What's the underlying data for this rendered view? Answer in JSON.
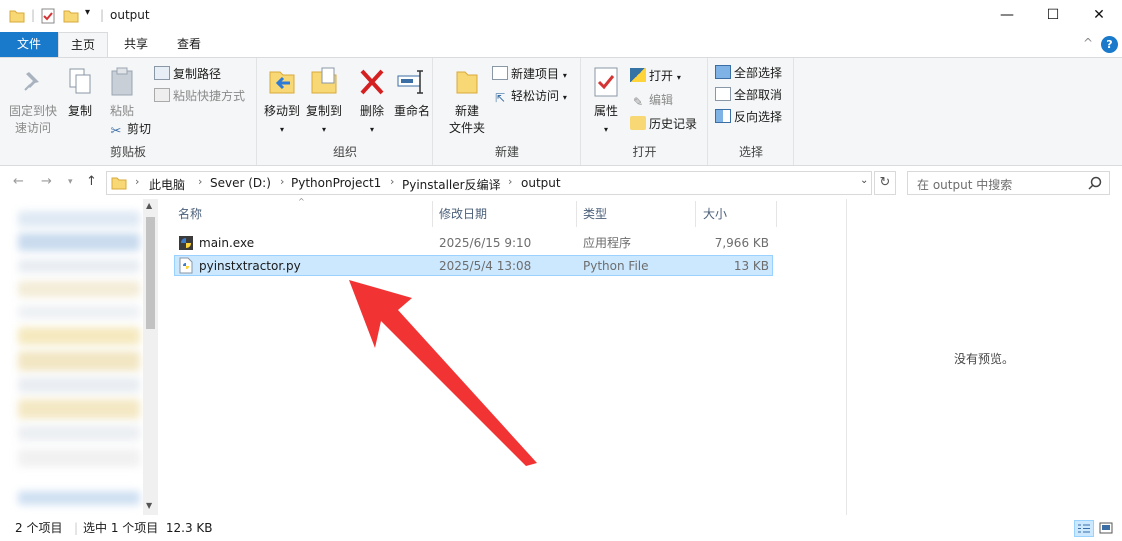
{
  "window": {
    "title": "output",
    "minimize_glyph": "—",
    "maximize_glyph": "☐",
    "close_glyph": "✕"
  },
  "ribbon_tabs": {
    "file": "文件",
    "home": "主页",
    "share": "共享",
    "view": "查看",
    "collapse_glyph": "^",
    "help_glyph": "?"
  },
  "ribbon": {
    "clipboard": {
      "label": "剪贴板",
      "pin_line1": "固定到快",
      "pin_line2": "速访问",
      "copy": "复制",
      "paste": "粘贴",
      "copy_path": "复制路径",
      "paste_shortcut": "粘贴快捷方式",
      "cut": "剪切"
    },
    "organize": {
      "label": "组织",
      "move_to": "移动到",
      "copy_to": "复制到",
      "delete": "删除",
      "rename": "重命名"
    },
    "new": {
      "label": "新建",
      "new_folder_line1": "新建",
      "new_folder_line2": "文件夹",
      "new_item": "新建项目",
      "easy_access": "轻松访问"
    },
    "open": {
      "label": "打开",
      "properties": "属性",
      "open": "打开",
      "edit": "编辑",
      "history": "历史记录"
    },
    "select": {
      "label": "选择",
      "select_all": "全部选择",
      "select_none": "全部取消",
      "invert": "反向选择"
    }
  },
  "address": {
    "crumbs": [
      "此电脑",
      "Sever (D:)",
      "PythonProject1",
      "Pyinstaller反编译",
      "output"
    ],
    "search_placeholder": "在 output 中搜索"
  },
  "columns": {
    "name": "名称",
    "date": "修改日期",
    "type": "类型",
    "size": "大小"
  },
  "files": [
    {
      "name": "main.exe",
      "date": "2025/6/15 9:10",
      "type": "应用程序",
      "size": "7,966 KB"
    },
    {
      "name": "pyinstxtractor.py",
      "date": "2025/5/4 13:08",
      "type": "Python File",
      "size": "13 KB"
    }
  ],
  "preview": {
    "empty_text": "没有预览。"
  },
  "status": {
    "item_count": "2 个项目",
    "selection": "选中 1 个项目  12.3 KB"
  },
  "colors": {
    "accent": "#1979ca",
    "selection_bg": "#cce8ff",
    "selection_border": "#99d1ff",
    "arrow": "#f23333",
    "folder": "#f8d775"
  }
}
